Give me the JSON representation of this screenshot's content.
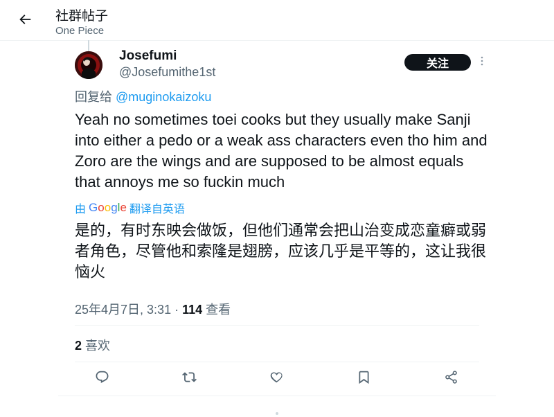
{
  "header": {
    "title": "社群帖子",
    "subtitle": "One Piece",
    "back_icon": "arrow-left-icon"
  },
  "author": {
    "display_name": "Josefumi",
    "handle": "@Josefumithe1st",
    "avatar": "avatar-image"
  },
  "follow_label": "关注",
  "reply": {
    "prefix": "回复给 ",
    "mention": "@muginokaizoku"
  },
  "tweet": {
    "text": "Yeah no sometimes toei cooks but they usually make Sanji into either a pedo or a weak ass characters even tho him and Zoro are the wings and are supposed to be almost equals that annoys me so fuckin much"
  },
  "translation": {
    "by": "由",
    "google": "Google",
    "label": "翻译自英语",
    "text": "是的，有时东映会做饭，但他们通常会把山治变成恋童癖或弱者角色，尽管他和索隆是翅膀，应该几乎是平等的，这让我很恼火"
  },
  "meta": {
    "date": "25年4月7日, 3:31",
    "separator": " · ",
    "views_count": "114",
    "views_label": " 查看"
  },
  "stats": {
    "likes_count": "2",
    "likes_label": " 喜欢"
  },
  "actions": [
    "reply-icon",
    "retweet-icon",
    "like-icon",
    "bookmark-icon",
    "share-icon"
  ],
  "colors": {
    "accent": "#1d9bf0",
    "text": "#0f1419",
    "secondary": "#536471",
    "follow_bg": "#0f1419"
  }
}
